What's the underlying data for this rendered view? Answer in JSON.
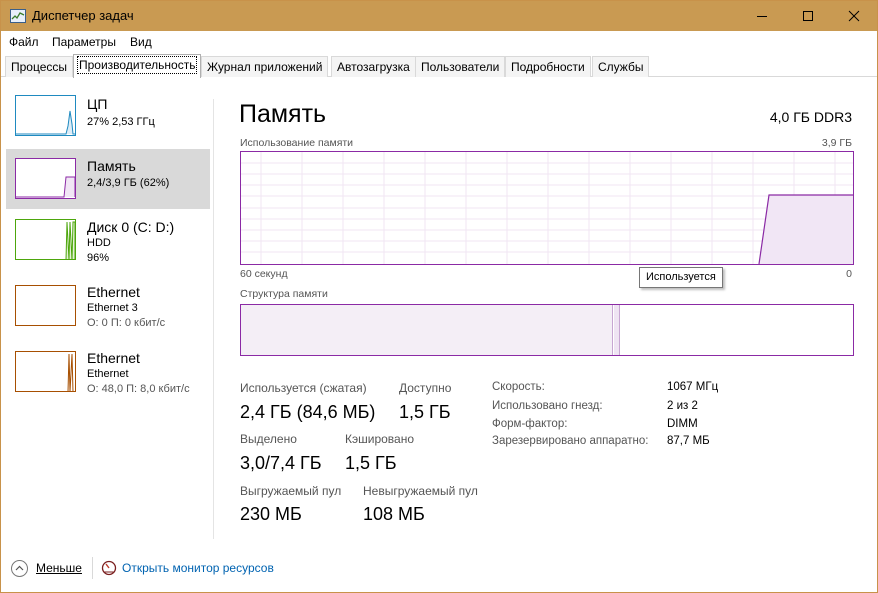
{
  "window": {
    "title": "Диспетчер задач"
  },
  "menu": [
    "Файл",
    "Параметры",
    "Вид"
  ],
  "tabs": [
    "Процессы",
    "Производительность",
    "Журнал приложений",
    "Автозагрузка",
    "Пользователи",
    "Подробности",
    "Службы"
  ],
  "active_tab": "Производительность",
  "sidebar": {
    "items": [
      {
        "title": "ЦП",
        "line1": "27%  2,53 ГГц",
        "line2": "",
        "color": "#1f8ac0",
        "icon": "cpu-graph-icon"
      },
      {
        "title": "Память",
        "line1": "2,4/3,9 ГБ (62%)",
        "line2": "",
        "color": "#8b2aa5",
        "icon": "memory-graph-icon"
      },
      {
        "title": "Диск 0 (C: D:)",
        "line1": "HDD",
        "line2": "96%",
        "color": "#4da60c",
        "icon": "disk-graph-icon"
      },
      {
        "title": "Ethernet",
        "line1": "Ethernet 3",
        "line2": "О: 0 П: 0 кбит/с",
        "color": "#a74f01",
        "icon": "ethernet-graph-icon"
      },
      {
        "title": "Ethernet",
        "line1": "Ethernet",
        "line2": "О: 48,0 П: 8,0 кбит/с",
        "color": "#a74f01",
        "icon": "ethernet-graph-icon"
      }
    ],
    "selected_index": 1
  },
  "memory": {
    "title": "Память",
    "spec": "4,0 ГБ DDR3",
    "usage_label": "Использование памяти",
    "usage_max": "3,9 ГБ",
    "time_left": "60 секунд",
    "time_right": "0",
    "tooltip": "Используется",
    "structure_label": "Структура памяти",
    "stats": {
      "in_use_label": "Используется (сжатая)",
      "in_use_value": "2,4 ГБ (84,6 МБ)",
      "available_label": "Доступно",
      "available_value": "1,5 ГБ",
      "committed_label": "Выделено",
      "committed_value": "3,0/7,4 ГБ",
      "cached_label": "Кэшировано",
      "cached_value": "1,5 ГБ",
      "paged_label": "Выгружаемый пул",
      "paged_value": "230 МБ",
      "nonpaged_label": "Невыгружаемый пул",
      "nonpaged_value": "108 МБ"
    },
    "properties": [
      {
        "label": "Скорость:",
        "value": "1067 МГц"
      },
      {
        "label": "Использовано гнезд:",
        "value": "2 из 2"
      },
      {
        "label": "Форм-фактор:",
        "value": "DIMM"
      },
      {
        "label": "Зарезервировано аппаратно:",
        "value": "87,7 МБ"
      }
    ]
  },
  "bottom": {
    "fewer_label": "Меньше",
    "resmon_label": "Открыть монитор ресурсов"
  },
  "colors": {
    "titlebar": "#c99a52",
    "memory_accent": "#8b2aa5",
    "link": "#0063b1"
  }
}
